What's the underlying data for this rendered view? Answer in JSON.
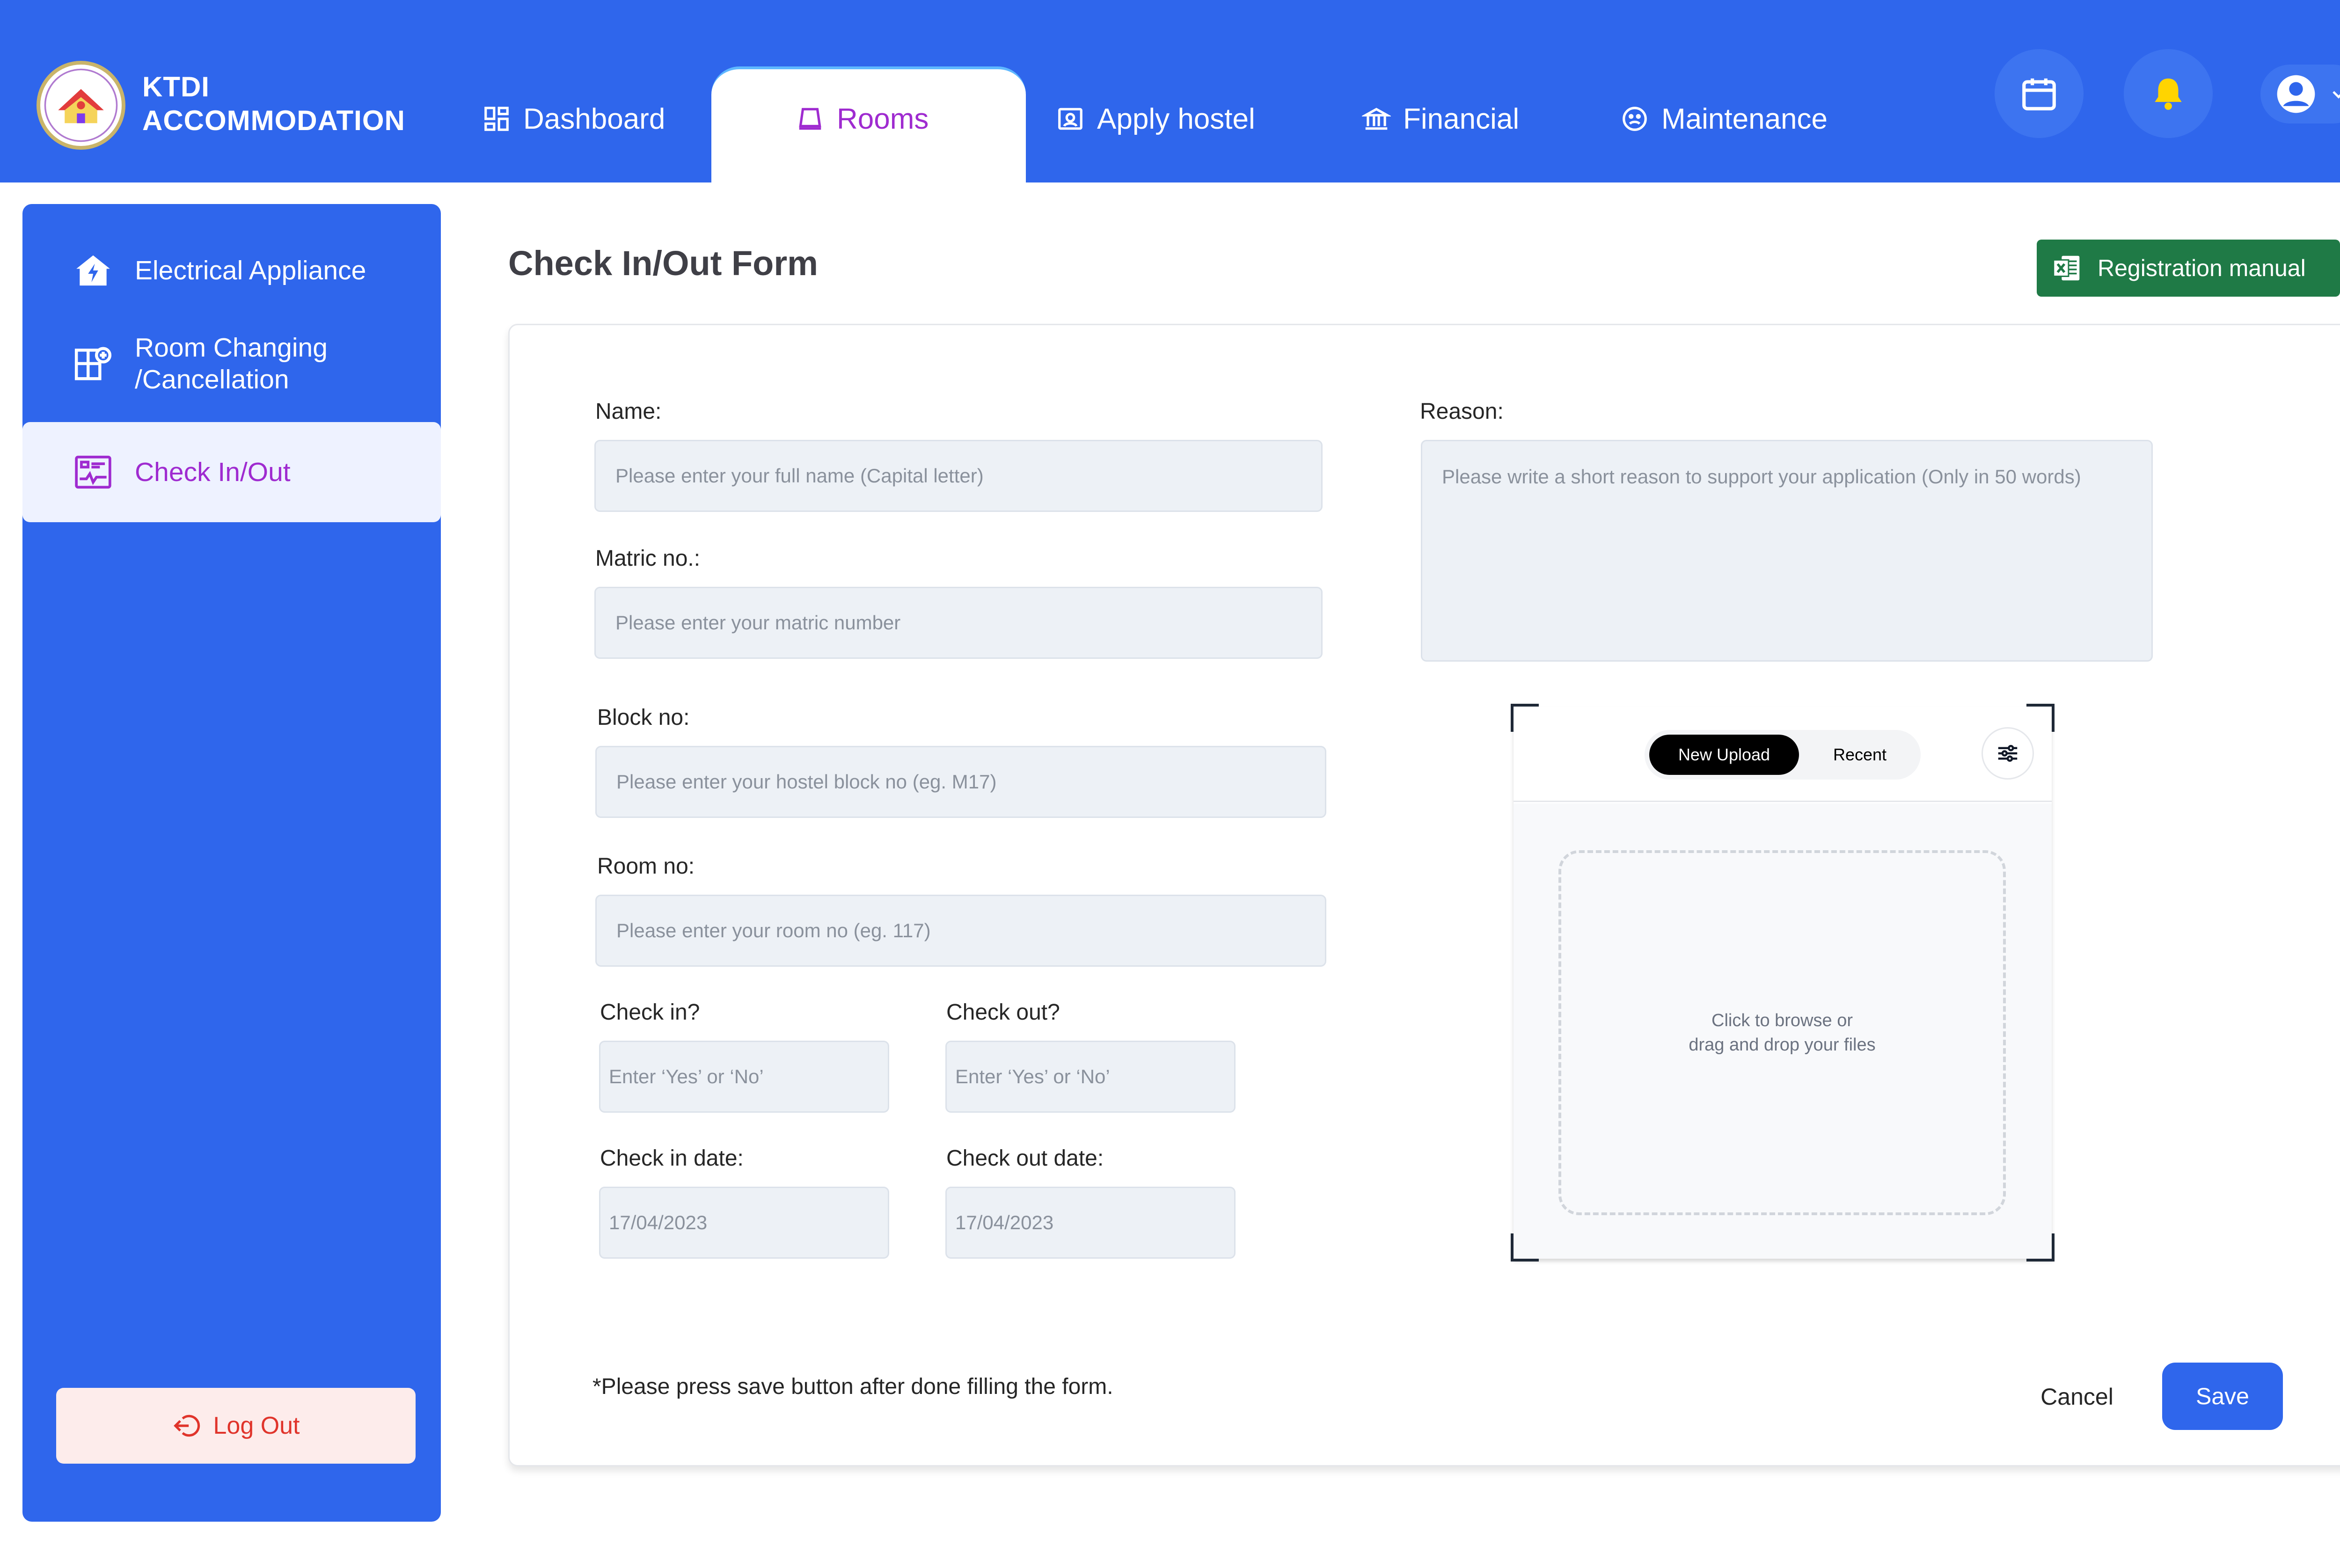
{
  "header": {
    "brand_line1": "KTDI",
    "brand_line2": "ACCOMMODATION",
    "logo_icon": "ktdi-crest-icon",
    "nav": [
      {
        "label": "Dashboard",
        "icon": "dashboard-grid-icon"
      },
      {
        "label": "Rooms",
        "icon": "room-icon",
        "active": true
      },
      {
        "label": "Apply hostel",
        "icon": "id-card-icon"
      },
      {
        "label": "Financial",
        "icon": "bank-icon"
      },
      {
        "label": "Maintenance",
        "icon": "sad-face-icon"
      }
    ],
    "actions": [
      "calendar-icon",
      "bell-icon",
      "user-avatar-icon"
    ]
  },
  "sidebar": {
    "items": [
      {
        "label": "Electrical Appliance",
        "icon": "electrical-house-icon"
      },
      {
        "label_line1": "Room Changing",
        "label_line2": "/Cancellation",
        "icon": "room-change-icon"
      },
      {
        "label": "Check In/Out",
        "icon": "checkin-board-icon",
        "active": true
      }
    ],
    "logout_label": "Log Out"
  },
  "main": {
    "title": "Check In/Out Form",
    "manual_label": "Registration manual",
    "form": {
      "name_label": "Name:",
      "name_placeholder": "Please enter your full name (Capital letter)",
      "matric_label": "Matric no.:",
      "matric_placeholder": "Please enter your matric number",
      "block_label": "Block no:",
      "block_placeholder": "Please enter your hostel block no (eg. M17)",
      "room_label": "Room no:",
      "room_placeholder": "Please enter your room no (eg. 117)",
      "checkin_label": "Check in?",
      "checkin_placeholder": "Enter ‘Yes’ or ‘No’",
      "checkout_label": "Check out?",
      "checkout_placeholder": "Enter ‘Yes’ or ‘No’",
      "checkin_date_label": "Check in date:",
      "checkin_date_value": "17/04/2023",
      "checkout_date_label": "Check out date:",
      "checkout_date_value": "17/04/2023",
      "reason_label": "Reason:",
      "reason_placeholder": "Please write a short reason to support your application (Only in 50 words)"
    },
    "upload": {
      "tab_new": "New Upload",
      "tab_recent": "Recent",
      "drop_line1": "Click to browse or",
      "drop_line2": "drag and drop your files"
    },
    "note": "*Please press save button after done filling the form.",
    "cancel_label": "Cancel",
    "save_label": "Save"
  },
  "colors": {
    "primary": "#2f66ec",
    "active_text": "#9f2bd0",
    "excel_green": "#1f7a46",
    "logout_red": "#e0342b",
    "bell_yellow": "#ffd400"
  }
}
